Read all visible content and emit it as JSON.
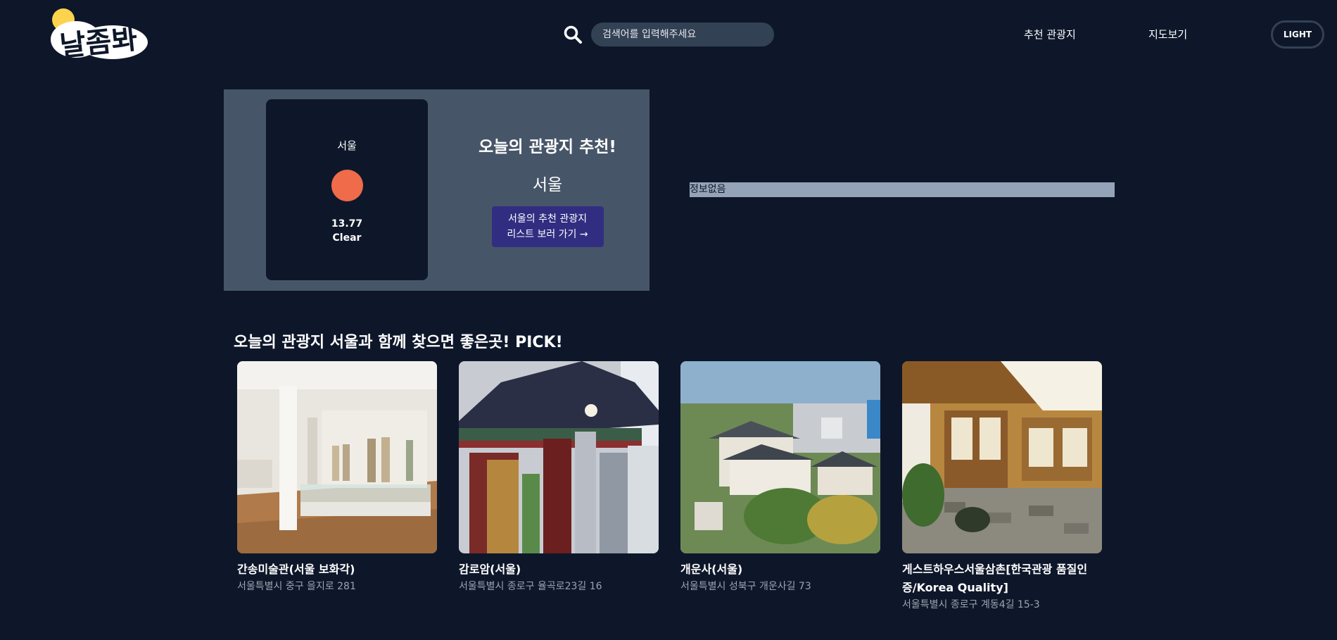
{
  "header": {
    "logo_text": "날좀봐",
    "search_placeholder": "검색어를 입력해주세요",
    "nav": [
      "추천 관광지",
      "지도보기"
    ],
    "theme_button": "LIGHT"
  },
  "recommend": {
    "weather_city": "서울",
    "temperature": "13.77",
    "condition": "Clear",
    "title": "오늘의 관광지 추천!",
    "city": "서울",
    "button_line1": "서울의 추천 관광지",
    "button_line2": "리스트 보러 가기 →",
    "info_text": "정보없음"
  },
  "picks": {
    "title": "오늘의 관광지 서울과 함께 찾으면 좋은곳! PICK!",
    "items": [
      {
        "name": "간송미술관(서울 보화각)",
        "address": "서울특별시 중구 을지로 281"
      },
      {
        "name": "감로암(서울)",
        "address": "서울특별시 종로구 율곡로23길 16"
      },
      {
        "name": "개운사(서울)",
        "address": "서울특별시 성북구 개운사길 73"
      },
      {
        "name": "게스트하우스서울삼촌[한국관광 품질인증/Korea Quality]",
        "address": "서울특별시 종로구 계동4길 15-3"
      }
    ]
  },
  "colors": {
    "background": "#0e172a",
    "panel": "#475569",
    "accent_button": "#312e81",
    "weather_dot": "#ef6b4a"
  },
  "icons": [
    "logo-sun-cloud",
    "search-icon"
  ]
}
